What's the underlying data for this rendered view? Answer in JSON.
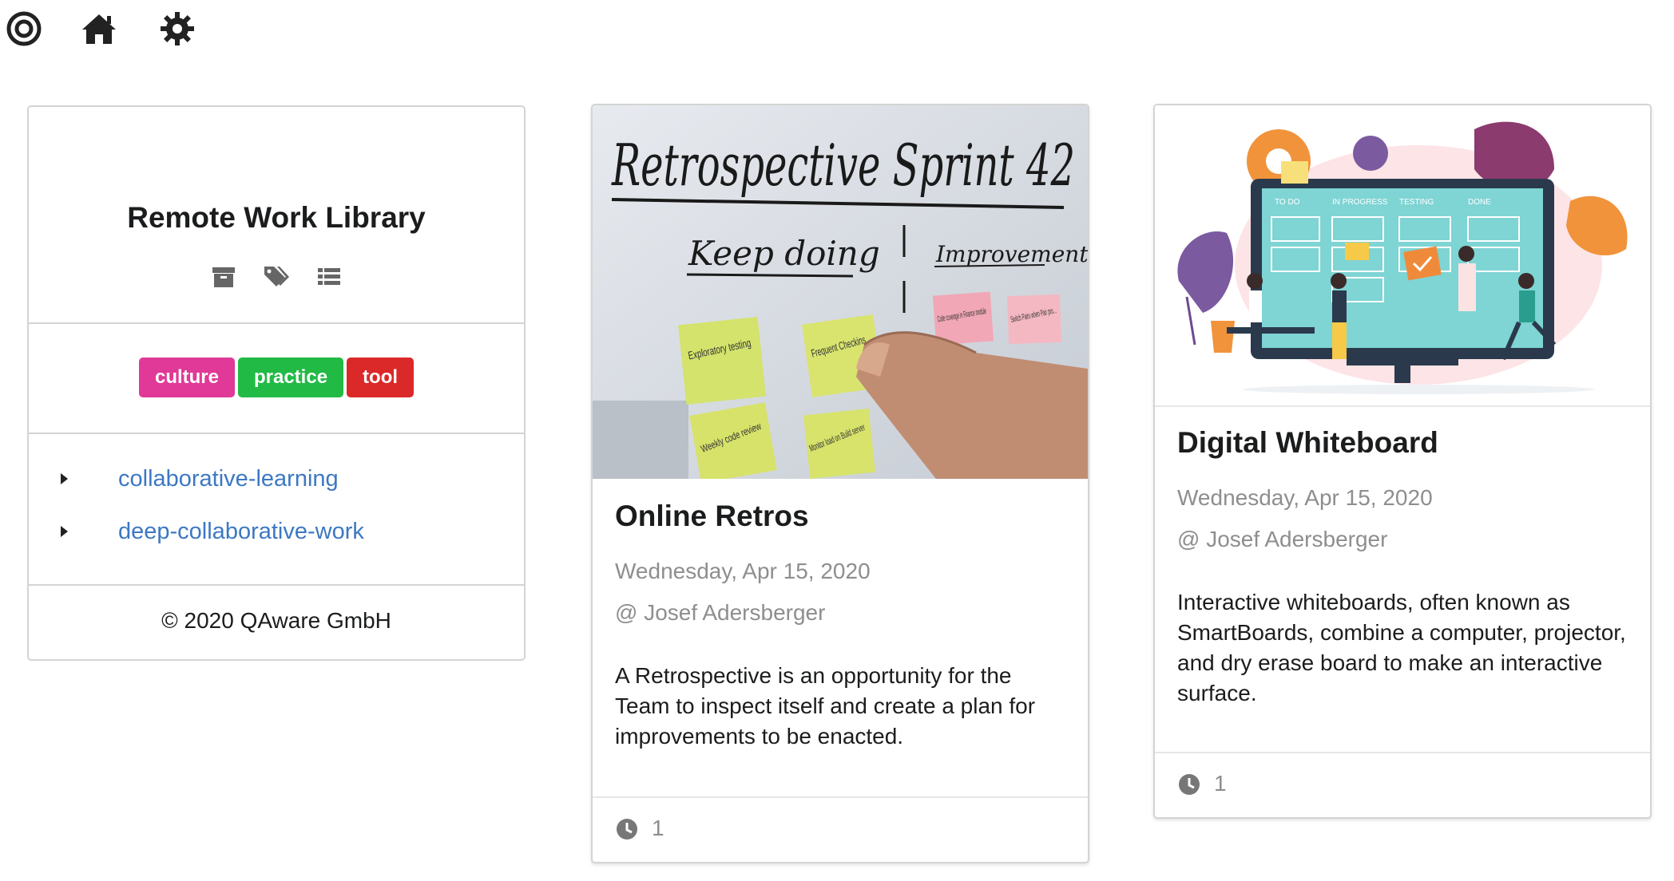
{
  "topbar": {
    "icons": [
      "target-icon",
      "home-icon",
      "gear-icon"
    ]
  },
  "sidebar": {
    "title": "Remote Work Library",
    "icons": [
      "archive-icon",
      "tags-icon",
      "list-icon"
    ],
    "tags": [
      {
        "label": "culture",
        "color": "#e03997"
      },
      {
        "label": "practice",
        "color": "#21ba45"
      },
      {
        "label": "tool",
        "color": "#db2828"
      }
    ],
    "links": [
      "collaborative-learning",
      "deep-collaborative-work"
    ],
    "copyright": "© 2020 QAware GmbH"
  },
  "posts": [
    {
      "image_text": {
        "heading": "Retrospective Sprint 42",
        "col1": "Keep doing",
        "col2": "Improvements",
        "notes": [
          "Exploratory testing",
          "Frequent Checkins",
          "Weekly code review",
          "Monitor load on Build server",
          "Code coverage in Finance module",
          "Switch Pairs when Pair pro..."
        ]
      },
      "title": "Online Retros",
      "date": "Wednesday, Apr 15, 2020",
      "author": "@ Josef Adersberger",
      "description": "A Retrospective is an opportunity for the Team to inspect itself and create a plan for improvements to be enacted.",
      "count": "1"
    },
    {
      "image_text": {
        "cols": [
          "TO DO",
          "IN PROGRESS",
          "TESTING",
          "DONE"
        ]
      },
      "title": "Digital Whiteboard",
      "date": "Wednesday, Apr 15, 2020",
      "author": "@ Josef Adersberger",
      "description": "Interactive whiteboards, often known as SmartBoards, combine a computer, projector, and dry erase board to make an interactive surface.",
      "count": "1"
    }
  ]
}
